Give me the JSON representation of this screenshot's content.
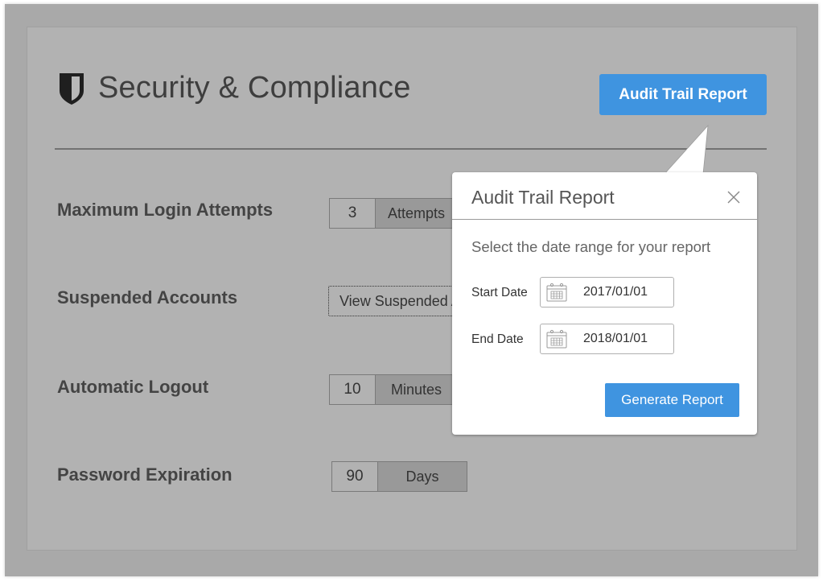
{
  "header": {
    "icon": "shield-icon",
    "title": "Security & Compliance",
    "audit_button_label": "Audit Trail Report"
  },
  "settings": [
    {
      "label": "Maximum Login Attempts",
      "value": "3",
      "unit": "Attempts"
    },
    {
      "label": "Suspended Accounts",
      "button_label": "View Suspended Accounts"
    },
    {
      "label": "Automatic Logout",
      "value": "10",
      "unit": "Minutes"
    },
    {
      "label": "Password Expiration",
      "value": "90",
      "unit": "Days"
    }
  ],
  "popover": {
    "title": "Audit Trail Report",
    "close_icon": "close-icon",
    "subtitle": "Select the date range for your report",
    "start_date_label": "Start Date",
    "start_date_value": "2017/01/01",
    "end_date_label": "End Date",
    "end_date_value": "2018/01/01",
    "calendar_icon": "calendar-icon",
    "generate_button_label": "Generate Report"
  },
  "colors": {
    "accent": "#3f94e0",
    "overlay": "#b2b2b2"
  }
}
